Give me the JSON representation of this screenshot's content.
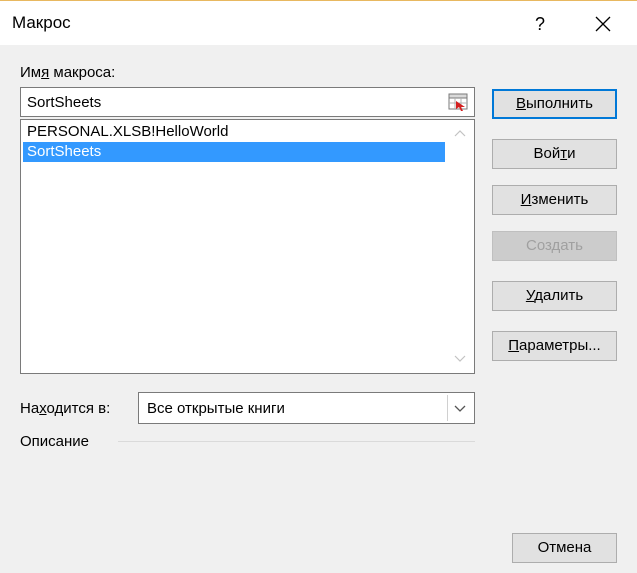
{
  "window": {
    "title": "Макрос",
    "help": "?"
  },
  "macro_name": {
    "label_pre": "Им",
    "label_ul": "я",
    "label_post": " макроса:",
    "value": "SortSheets"
  },
  "macro_list": {
    "items": [
      "PERSONAL.XLSB!HelloWorld",
      "SortSheets"
    ],
    "selected_index": 1
  },
  "buttons": {
    "run": {
      "pre": "",
      "ul": "В",
      "post": "ыполнить"
    },
    "step": {
      "pre": "Вой",
      "ul": "т",
      "post": "и"
    },
    "edit": {
      "pre": "",
      "ul": "И",
      "post": "зменить"
    },
    "create": {
      "label": "Создать"
    },
    "delete": {
      "pre": "",
      "ul": "У",
      "post": "далить"
    },
    "options": {
      "pre": "",
      "ul": "П",
      "post": "араметры..."
    },
    "cancel": {
      "label": "Отмена"
    }
  },
  "location": {
    "label_pre": "На",
    "label_ul": "х",
    "label_post": "одится в:",
    "value": "Все открытые книги"
  },
  "description": {
    "label": "Описание"
  },
  "colors": {
    "selection": "#3399ff",
    "default_button_border": "#0078d7",
    "dialog_background": "#f0f0f0"
  }
}
